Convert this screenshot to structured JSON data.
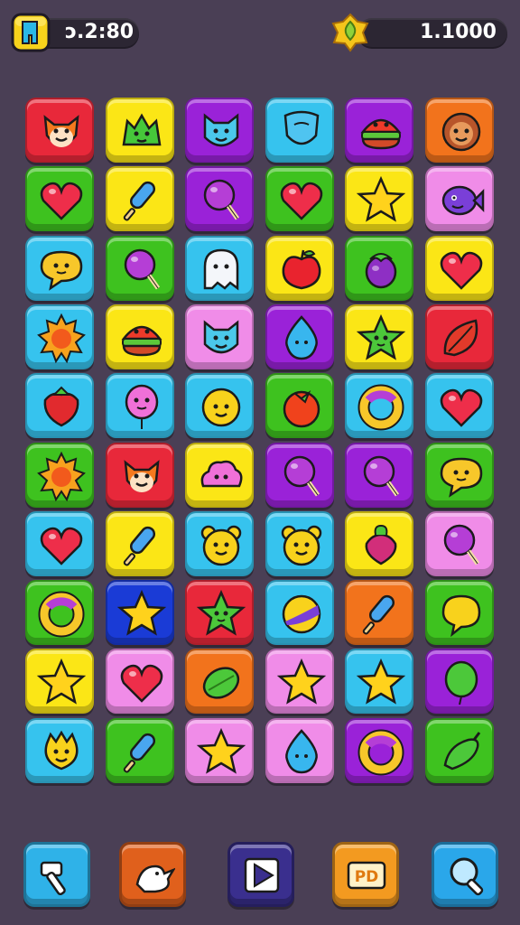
{
  "hud": {
    "timer_text": "ↄ.2:80",
    "coin_text": "1.1000",
    "timer_icon": "boot-icon",
    "coin_icon": "coin-gem-icon"
  },
  "colors": {
    "red": "#e8283a",
    "yellow": "#fbe616",
    "purple": "#9a22d8",
    "sky": "#36c3ee",
    "orange": "#f2731c",
    "green": "#3ec21f",
    "pink": "#f08ce8",
    "navy": "#1a3bd6"
  },
  "board": {
    "rows": 10,
    "cols": 6,
    "tiles": [
      [
        {
          "bg": "red",
          "icon": "fox-face"
        },
        {
          "bg": "yellow",
          "icon": "green-blob"
        },
        {
          "bg": "purple",
          "icon": "cat-face"
        },
        {
          "bg": "sky",
          "icon": "shield-face"
        },
        {
          "bg": "purple",
          "icon": "burger-monster"
        },
        {
          "bg": "orange",
          "icon": "lion-face"
        }
      ],
      [
        {
          "bg": "green",
          "icon": "heart"
        },
        {
          "bg": "yellow",
          "icon": "popsicle"
        },
        {
          "bg": "purple",
          "icon": "lollipop"
        },
        {
          "bg": "green",
          "icon": "heart"
        },
        {
          "bg": "yellow",
          "icon": "star"
        },
        {
          "bg": "pink",
          "icon": "fish-monster"
        }
      ],
      [
        {
          "bg": "sky",
          "icon": "speech-face"
        },
        {
          "bg": "green",
          "icon": "lollipop"
        },
        {
          "bg": "sky",
          "icon": "ghost"
        },
        {
          "bg": "yellow",
          "icon": "apple"
        },
        {
          "bg": "green",
          "icon": "eggplant"
        },
        {
          "bg": "yellow",
          "icon": "heart"
        }
      ],
      [
        {
          "bg": "sky",
          "icon": "sun"
        },
        {
          "bg": "yellow",
          "icon": "burger-monster"
        },
        {
          "bg": "pink",
          "icon": "cat-face"
        },
        {
          "bg": "purple",
          "icon": "drop-face"
        },
        {
          "bg": "yellow",
          "icon": "star-face"
        },
        {
          "bg": "red",
          "icon": "leaf"
        }
      ],
      [
        {
          "bg": "sky",
          "icon": "strawberry"
        },
        {
          "bg": "sky",
          "icon": "balloon-face"
        },
        {
          "bg": "sky",
          "icon": "smiley"
        },
        {
          "bg": "green",
          "icon": "tomato"
        },
        {
          "bg": "sky",
          "icon": "ring"
        },
        {
          "bg": "sky",
          "icon": "heart"
        }
      ],
      [
        {
          "bg": "green",
          "icon": "sun"
        },
        {
          "bg": "red",
          "icon": "fox-face"
        },
        {
          "bg": "yellow",
          "icon": "cloud-monster"
        },
        {
          "bg": "purple",
          "icon": "lollipop"
        },
        {
          "bg": "purple",
          "icon": "lollipop"
        },
        {
          "bg": "green",
          "icon": "speech-face"
        }
      ],
      [
        {
          "bg": "sky",
          "icon": "heart"
        },
        {
          "bg": "yellow",
          "icon": "popsicle"
        },
        {
          "bg": "sky",
          "icon": "bear-face"
        },
        {
          "bg": "sky",
          "icon": "bear-face"
        },
        {
          "bg": "yellow",
          "icon": "radish"
        },
        {
          "bg": "pink",
          "icon": "lollipop"
        }
      ],
      [
        {
          "bg": "green",
          "icon": "ring"
        },
        {
          "bg": "navy",
          "icon": "star"
        },
        {
          "bg": "red",
          "icon": "star-face"
        },
        {
          "bg": "sky",
          "icon": "beach-ball"
        },
        {
          "bg": "orange",
          "icon": "popsicle"
        },
        {
          "bg": "green",
          "icon": "speech-bubble"
        }
      ],
      [
        {
          "bg": "yellow",
          "icon": "star"
        },
        {
          "bg": "pink",
          "icon": "heart"
        },
        {
          "bg": "orange",
          "icon": "lime"
        },
        {
          "bg": "pink",
          "icon": "star"
        },
        {
          "bg": "sky",
          "icon": "star"
        },
        {
          "bg": "purple",
          "icon": "balloon"
        }
      ],
      [
        {
          "bg": "sky",
          "icon": "dino-face"
        },
        {
          "bg": "green",
          "icon": "popsicle"
        },
        {
          "bg": "pink",
          "icon": "star"
        },
        {
          "bg": "pink",
          "icon": "drop-face"
        },
        {
          "bg": "purple",
          "icon": "ring"
        },
        {
          "bg": "green",
          "icon": "pepper"
        }
      ]
    ]
  },
  "toolbar": {
    "items": [
      {
        "name": "hammer-tool",
        "bg": "#2fb2e8",
        "icon": "hammer"
      },
      {
        "name": "bird-tool",
        "bg": "#e0601c",
        "icon": "bird"
      },
      {
        "name": "shuffle-tool",
        "bg": "#3a2f8e",
        "icon": "play-arrow"
      },
      {
        "name": "pd-tool",
        "bg": "#f39a20",
        "icon": "pd-box"
      },
      {
        "name": "magnifier-tool",
        "bg": "#2aa7ea",
        "icon": "magnifier"
      }
    ],
    "pd_label": "PD"
  }
}
